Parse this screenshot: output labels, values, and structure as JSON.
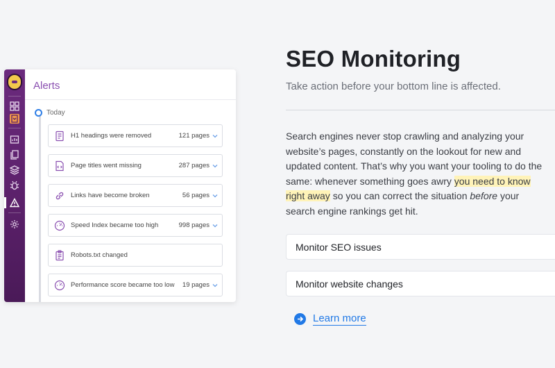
{
  "app": {
    "panel_title": "Alerts",
    "today_label": "Today",
    "rail_icons": [
      "logo-icon",
      "dashboard-icon",
      "document-icon",
      "chart-icon",
      "pages-icon",
      "layers-icon",
      "bug-icon",
      "warning-icon",
      "settings-icon"
    ],
    "alerts": [
      {
        "text": "H1 headings were removed",
        "count": "121 pages",
        "icon": "document-lines-icon"
      },
      {
        "text": "Page titles went missing",
        "count": "287 pages",
        "icon": "document-code-icon"
      },
      {
        "text": "Links have become broken",
        "count": "56 pages",
        "icon": "link-icon"
      },
      {
        "text": "Speed Index became too high",
        "count": "998 pages",
        "icon": "gauge-icon"
      },
      {
        "text": "Robots.txt changed",
        "count": "",
        "icon": "clipboard-icon"
      },
      {
        "text": "Performance score became too low",
        "count": "19 pages",
        "icon": "gauge-icon"
      }
    ]
  },
  "content": {
    "title": "SEO Monitoring",
    "subtitle": "Take action before your bottom line is affected.",
    "para_part1": "Search engines never stop crawling and analyzing your website’s pages, constantly on the lookout for new and updated content. That’s why you want your tooling to do the same: whenever something goes awry ",
    "para_highlight": "you need to know right away",
    "para_part2": " so you can correct the situation ",
    "para_em": "before",
    "para_part3": " your search engine rankings get hit.",
    "cards": [
      "Monitor SEO issues",
      "Monitor website changes"
    ],
    "learn_more": "Learn more"
  },
  "colors": {
    "accent_purple": "#8a4fb0",
    "rail_purple": "#5a2069",
    "link_blue": "#2179e6",
    "highlight": "#fff3b8"
  }
}
